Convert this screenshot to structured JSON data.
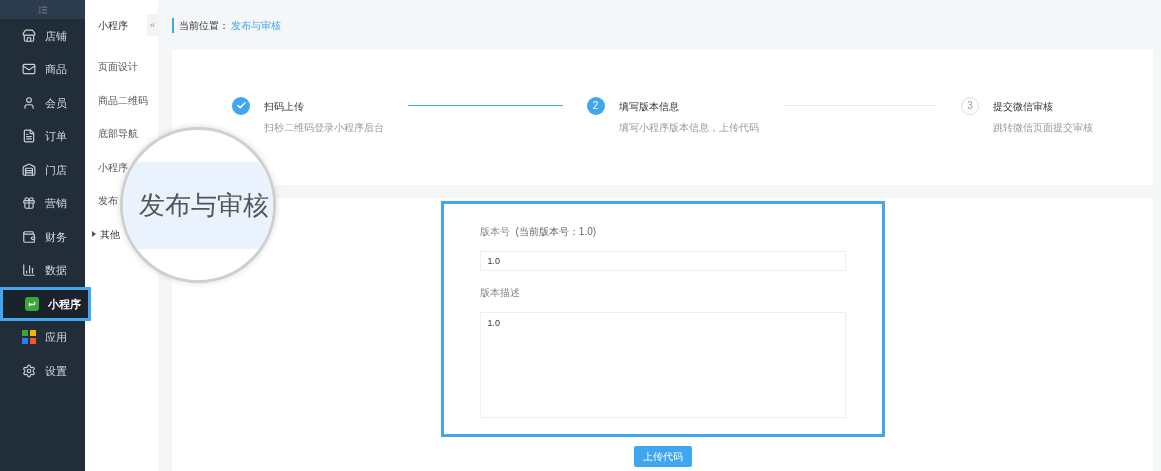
{
  "sidebar": {
    "items": [
      {
        "label": "店铺",
        "selected": false
      },
      {
        "label": "商品",
        "selected": false
      },
      {
        "label": "会员",
        "selected": false
      },
      {
        "label": "订单",
        "selected": false
      },
      {
        "label": "门店",
        "selected": false
      },
      {
        "label": "营销",
        "selected": false
      },
      {
        "label": "财务",
        "selected": false
      },
      {
        "label": "数据",
        "selected": false
      },
      {
        "label": "小程序",
        "selected": true
      },
      {
        "label": "应用",
        "selected": false
      },
      {
        "label": "设置",
        "selected": false
      }
    ]
  },
  "subnav": {
    "title": "小程序",
    "collapse": "«",
    "items": [
      {
        "label": "页面设计",
        "kind": "item"
      },
      {
        "label": "商品二维码",
        "kind": "item"
      },
      {
        "label": "底部导航",
        "kind": "item"
      },
      {
        "label": "小程序",
        "kind": "item"
      },
      {
        "label": "发布",
        "kind": "item"
      },
      {
        "label": "其他",
        "kind": "group"
      }
    ]
  },
  "magnifier": {
    "text": "发布与审核"
  },
  "breadcrumb": {
    "label": "当前位置：",
    "current": "发布与审核"
  },
  "steps": [
    {
      "kind": "done",
      "title": "扫码上传",
      "desc": "扫秒二维码登录小程序后台"
    },
    {
      "kind": "current",
      "number": "2",
      "title": "填写版本信息",
      "desc": "填写小程序版本信息，上传代码"
    },
    {
      "kind": "pending",
      "number": "3",
      "title": "提交微信审核",
      "desc": "跳转微信页面提交审核"
    }
  ],
  "form": {
    "highlighted": true,
    "version_label": "版本号",
    "version_hint": "(当前版本号：1.0)",
    "version_value": "1.0",
    "desc_label": "版本描述",
    "desc_value": "1.0",
    "submit": "上传代码"
  }
}
